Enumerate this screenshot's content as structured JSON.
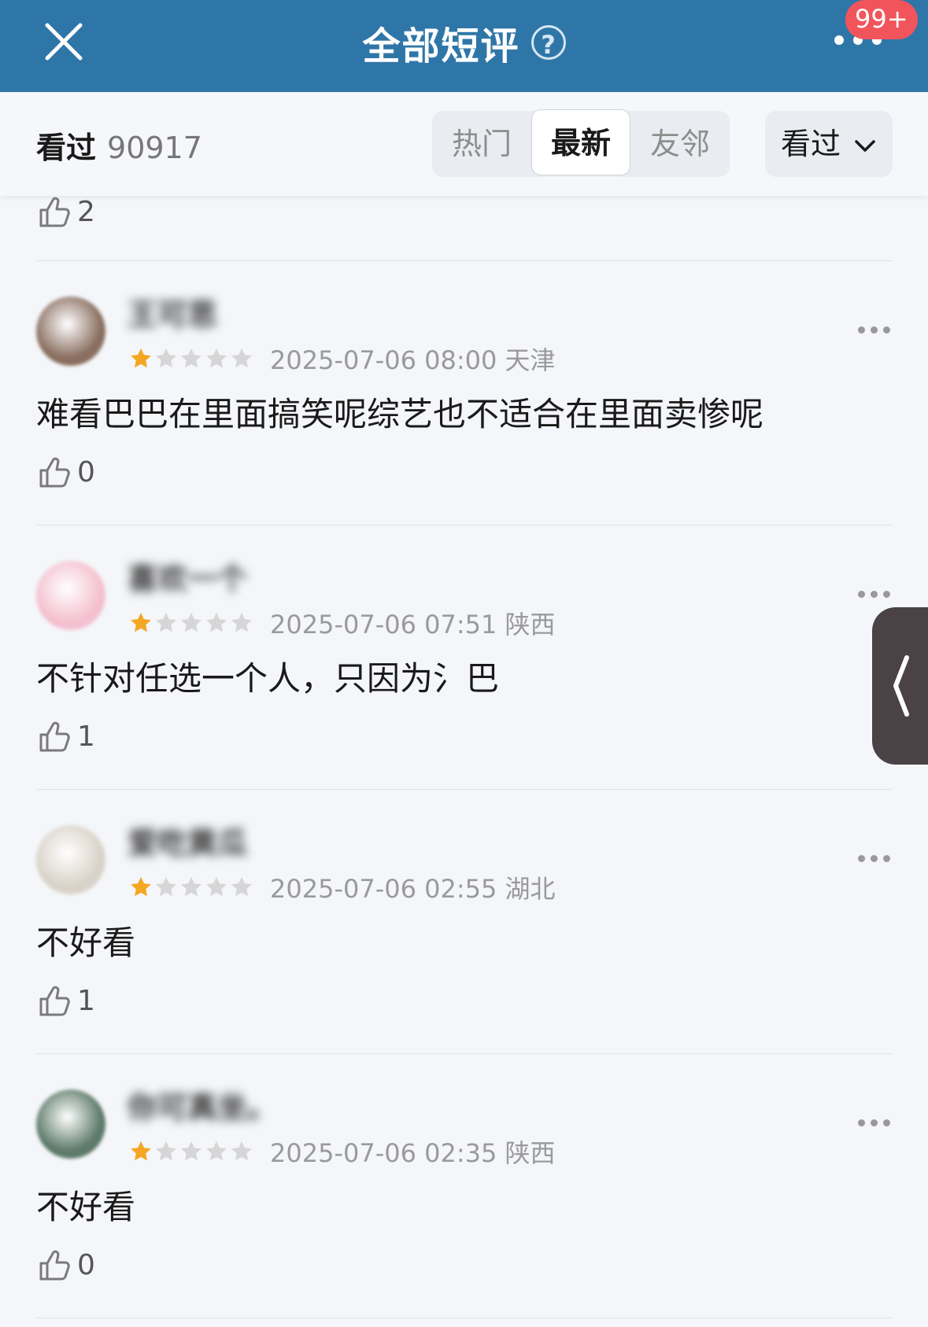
{
  "header": {
    "title": "全部短评",
    "help_glyph": "?",
    "badge": "99+"
  },
  "filter": {
    "watched_label": "看过",
    "watched_count": "90917",
    "tabs": [
      "热门",
      "最新",
      "友邻"
    ],
    "active_tab": "最新",
    "dropdown_label": "看过"
  },
  "partial_like_count": "2",
  "reviews": [
    {
      "username": "王可思",
      "rating": 1,
      "time": "2025-07-06 08:00",
      "region": "天津",
      "text": "难看巴巴在里面搞笑呢综艺也不适合在里面卖惨呢",
      "likes": "0",
      "avatar_color": "#8a6f60"
    },
    {
      "username": "喜欢一个",
      "rating": 1,
      "time": "2025-07-06 07:51",
      "region": "陕西",
      "text": "不针对任选一个人，只因为氵巴",
      "likes": "1",
      "avatar_color": "#f4c0cf"
    },
    {
      "username": "爱吃黄瓜",
      "rating": 1,
      "time": "2025-07-06 02:55",
      "region": "湖北",
      "text": "不好看",
      "likes": "1",
      "avatar_color": "#d9d2c8"
    },
    {
      "username": "你可真坐。",
      "rating": 1,
      "time": "2025-07-06 02:35",
      "region": "陕西",
      "text": "不好看",
      "likes": "0",
      "avatar_color": "#5d7a6a"
    }
  ],
  "colors": {
    "header_bg": "#2f76a8",
    "star_on": "#f5a623",
    "star_off": "#d6d6d6",
    "badge_bg": "#f2545b"
  }
}
